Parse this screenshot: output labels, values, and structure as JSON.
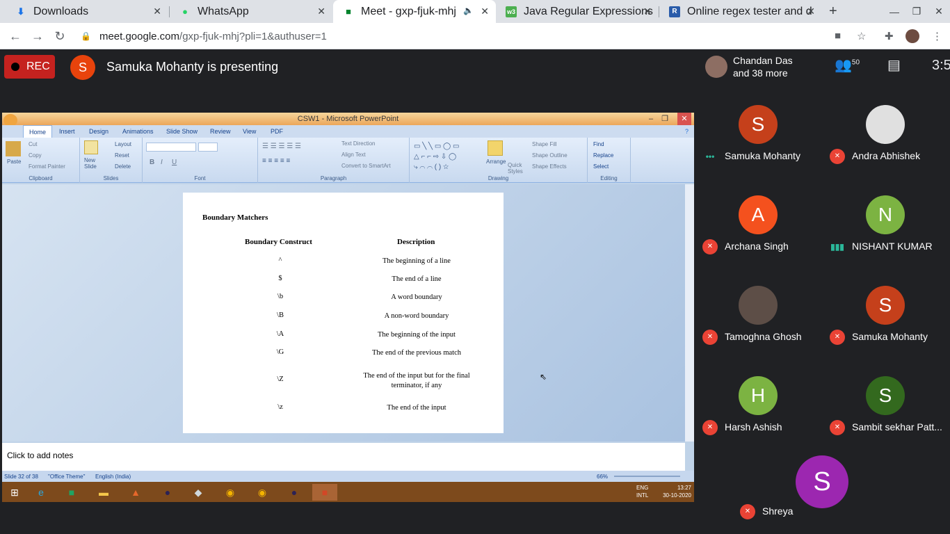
{
  "browser": {
    "tabs": [
      {
        "title": "Downloads",
        "icon": "download-icon"
      },
      {
        "title": "WhatsApp",
        "icon": "whatsapp-icon"
      },
      {
        "title": "Meet - gxp-fjuk-mhj",
        "icon": "meet-icon"
      },
      {
        "title": "Java Regular Expressions",
        "icon": "w3-icon"
      },
      {
        "title": "Online regex tester and d",
        "icon": "regex-icon"
      }
    ],
    "url_host": "meet.google.com",
    "url_path": "/gxp-fjuk-mhj?pli=1&authuser=1"
  },
  "meet": {
    "rec_label": "REC",
    "presenter_initial": "S",
    "presenter_text": "Samuka Mohanty is presenting",
    "participants_summary_line1": "Chandan Das",
    "participants_summary_line2": "and 38 more",
    "people_count": "50",
    "clock": "3:5",
    "participants": [
      {
        "name": "Samuka Mohanty",
        "initial": "S",
        "color": "#c5401b",
        "status": "speaking-dots"
      },
      {
        "name": "Andra Abhishek",
        "initial": "",
        "color": "#e0e0e0",
        "status": "muted"
      },
      {
        "name": "Archana Singh",
        "initial": "A",
        "color": "#f4511e",
        "status": "muted"
      },
      {
        "name": "NISHANT KUMAR",
        "initial": "N",
        "color": "#7cb342",
        "status": "speaking"
      },
      {
        "name": "Tamoghna Ghosh",
        "initial": "",
        "color": "#5d4e47",
        "status": "muted"
      },
      {
        "name": "Samuka Mohanty",
        "initial": "S",
        "color": "#c5401b",
        "status": "muted"
      },
      {
        "name": "Harsh Ashish",
        "initial": "H",
        "color": "#7cb342",
        "status": "muted"
      },
      {
        "name": "Sambit sekhar Patt...",
        "initial": "S",
        "color": "#33691e",
        "status": "muted"
      },
      {
        "name": "Shreya",
        "initial": "S",
        "color": "#9c27b0",
        "status": "muted"
      }
    ]
  },
  "ppt": {
    "window_title": "CSW1 - Microsoft PowerPoint",
    "ribbon_tabs": [
      "Home",
      "Insert",
      "Design",
      "Animations",
      "Slide Show",
      "Review",
      "View",
      "PDF"
    ],
    "groups": {
      "clipboard": {
        "label": "Clipboard",
        "paste": "Paste",
        "cut": "Cut",
        "copy": "Copy",
        "format_painter": "Format Painter"
      },
      "slides": {
        "label": "Slides",
        "new_slide": "New Slide",
        "layout": "Layout",
        "reset": "Reset",
        "delete": "Delete"
      },
      "font": {
        "label": "Font"
      },
      "paragraph": {
        "label": "Paragraph",
        "text_direction": "Text Direction",
        "align_text": "Align Text",
        "smartart": "Convert to SmartArt"
      },
      "drawing": {
        "label": "Drawing",
        "arrange": "Arrange",
        "quick_styles": "Quick Styles",
        "shape_fill": "Shape Fill",
        "shape_outline": "Shape Outline",
        "shape_effects": "Shape Effects"
      },
      "editing": {
        "label": "Editing",
        "find": "Find",
        "replace": "Replace",
        "select": "Select"
      }
    },
    "slide": {
      "title": "Boundary Matchers",
      "col1_header": "Boundary Construct",
      "col2_header": "Description",
      "rows": [
        {
          "construct": "^",
          "description": "The beginning of a line"
        },
        {
          "construct": "$",
          "description": "The end of a line"
        },
        {
          "construct": "\\b",
          "description": "A word boundary"
        },
        {
          "construct": "\\B",
          "description": "A non-word boundary"
        },
        {
          "construct": "\\A",
          "description": "The beginning of the input"
        },
        {
          "construct": "\\G",
          "description": "The end of the previous match"
        },
        {
          "construct": "\\Z",
          "description": "The end of the input but for the final terminator, if any"
        },
        {
          "construct": "\\z",
          "description": "The end of the input"
        }
      ]
    },
    "notes_placeholder": "Click to add notes",
    "status": {
      "slide": "Slide 32 of 38",
      "theme": "\"Office Theme\"",
      "language": "English (India)",
      "zoom": "66%"
    },
    "taskbar": {
      "lang1": "ENG",
      "lang2": "INTL",
      "time": "13:27",
      "date": "30-10-2020"
    }
  }
}
